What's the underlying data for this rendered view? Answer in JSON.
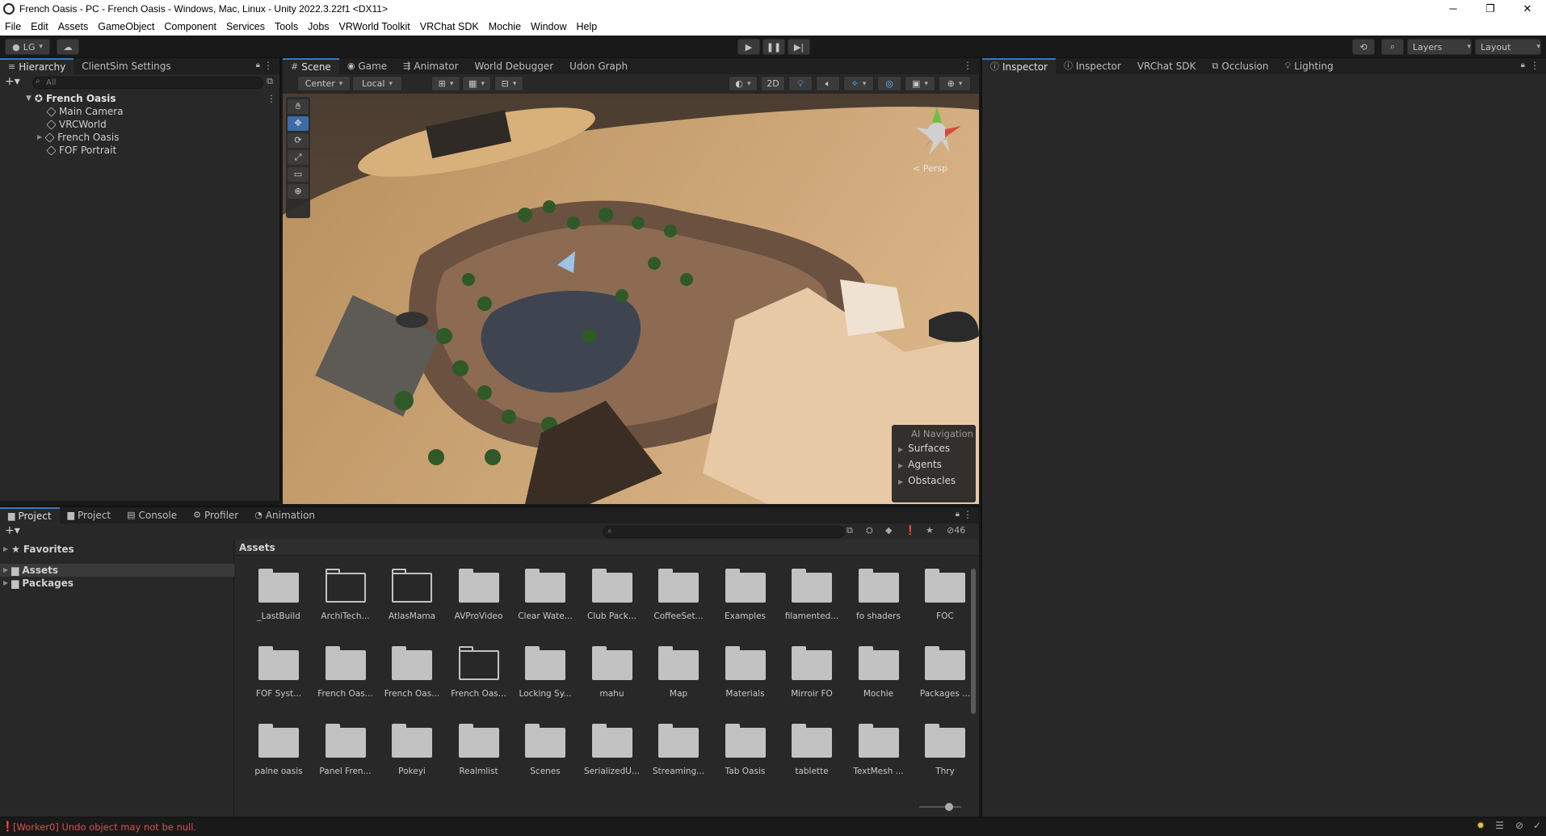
{
  "window": {
    "title": "French Oasis - PC - French Oasis - Windows, Mac, Linux - Unity 2022.3.22f1 <DX11>",
    "minimize": "─",
    "maximize": "❐",
    "close": "✕"
  },
  "menu": [
    "File",
    "Edit",
    "Assets",
    "GameObject",
    "Component",
    "Services",
    "Tools",
    "Jobs",
    "VRWorld Toolkit",
    "VRChat SDK",
    "Mochie",
    "Window",
    "Help"
  ],
  "toolbar": {
    "account": "LG",
    "layers": "Layers",
    "layout": "Layout"
  },
  "hierarchy": {
    "tabs": [
      "Hierarchy",
      "ClientSim Settings"
    ],
    "search_placeholder": "All",
    "scene_name": "French Oasis",
    "items": [
      "Main Camera",
      "VRCWorld",
      "French Oasis",
      "FOF Portrait"
    ]
  },
  "scene": {
    "tabs": [
      "Scene",
      "Game",
      "Animator",
      "World Debugger",
      "Udon Graph"
    ],
    "pivot": "Center",
    "space": "Local",
    "mode_2d": "2D",
    "persp": "< Persp",
    "ai_nav": {
      "title": "AI Navigation",
      "items": [
        "Surfaces",
        "Agents",
        "Obstacles"
      ]
    }
  },
  "inspector": {
    "tabs": [
      "Inspector",
      "Inspector",
      "VRChat SDK",
      "Occlusion",
      "Lighting"
    ]
  },
  "project": {
    "tabs": [
      "Project",
      "Project",
      "Console",
      "Profiler",
      "Animation"
    ],
    "tree": [
      "Favorites",
      "Assets",
      "Packages"
    ],
    "breadcrumb": "Assets",
    "hidden_count": "46",
    "folders": [
      {
        "name": "_LastBuild",
        "empty": false
      },
      {
        "name": "ArchiTech...",
        "empty": true
      },
      {
        "name": "AtlasMama",
        "empty": true
      },
      {
        "name": "AVProVideo",
        "empty": false
      },
      {
        "name": "Clear Wate...",
        "empty": false
      },
      {
        "name": "Club Pack...",
        "empty": false
      },
      {
        "name": "CoffeeSet...",
        "empty": false
      },
      {
        "name": "Examples",
        "empty": false
      },
      {
        "name": "filamented...",
        "empty": false
      },
      {
        "name": "fo shaders",
        "empty": false
      },
      {
        "name": "FOC",
        "empty": false
      },
      {
        "name": "FOF Syst...",
        "empty": false
      },
      {
        "name": "French Oas...",
        "empty": false
      },
      {
        "name": "French Oas...",
        "empty": false
      },
      {
        "name": "French Oas...",
        "empty": true
      },
      {
        "name": "Locking Sy...",
        "empty": false
      },
      {
        "name": "mahu",
        "empty": false
      },
      {
        "name": "Map",
        "empty": false
      },
      {
        "name": "Materials",
        "empty": false
      },
      {
        "name": "Mirroir FO",
        "empty": false
      },
      {
        "name": "Mochie",
        "empty": false
      },
      {
        "name": "Packages ...",
        "empty": false
      },
      {
        "name": "palne oasis",
        "empty": false
      },
      {
        "name": "Panel Fren...",
        "empty": false
      },
      {
        "name": "Pokeyi",
        "empty": false
      },
      {
        "name": "Realmlist",
        "empty": false
      },
      {
        "name": "Scenes",
        "empty": false
      },
      {
        "name": "SerializedU...",
        "empty": false
      },
      {
        "name": "Streaming...",
        "empty": false
      },
      {
        "name": "Tab Oasis",
        "empty": false
      },
      {
        "name": "tablette",
        "empty": false
      },
      {
        "name": "TextMesh ...",
        "empty": false
      },
      {
        "name": "Thry",
        "empty": false
      }
    ]
  },
  "status": {
    "message": "[Worker0] Undo object may not be null.",
    "error_color": "#d9534f"
  }
}
